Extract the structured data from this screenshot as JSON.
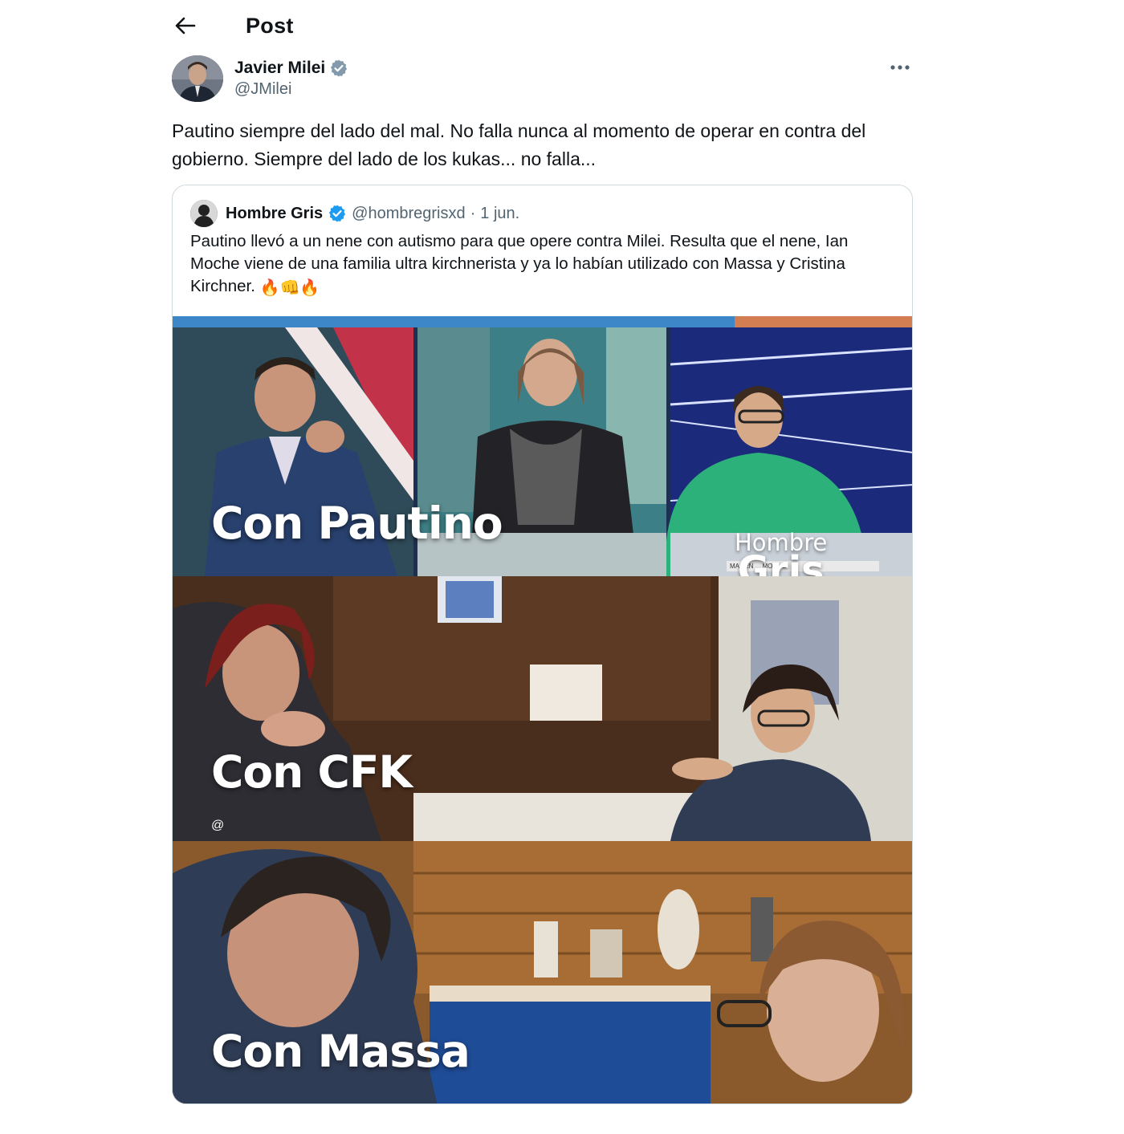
{
  "header": {
    "title": "Post",
    "back_icon": "arrow-left-icon"
  },
  "post": {
    "author_name": "Javier Milei",
    "author_handle": "@JMilei",
    "verified": true,
    "text": "Pautino siempre del lado del mal. No falla nunca al momento de operar en contra del gobierno. Siempre del lado de los kukas... no falla...",
    "more_icon": "more-horizontal-icon"
  },
  "quote": {
    "author_name": "Hombre Gris",
    "author_handle": "@hombregrisxd",
    "separator": "·",
    "date": "1 jun.",
    "verified": true,
    "text": "Pautino llevó a un nene con autismo para  que opere contra Milei. Resulta que el nene, Ian Moche viene de una familia ultra kirchnerista y ya lo habían utilizado con Massa y Cristina Kirchner.",
    "emojis": [
      "🔥",
      "👊",
      "🔥"
    ],
    "media": {
      "panels": [
        {
          "caption": "Con Pautino"
        },
        {
          "caption": "Con CFK"
        },
        {
          "caption": "Con Massa"
        }
      ],
      "watermark_line1": "Hombre",
      "watermark_line2": "Gris",
      "ticker": "MA  LEN  ...  MOCHE",
      "at_mark": "@"
    }
  },
  "colors": {
    "text": "#0f1419",
    "secondary": "#536471",
    "verified": "#1d9bf0",
    "border": "#cfd9de"
  }
}
